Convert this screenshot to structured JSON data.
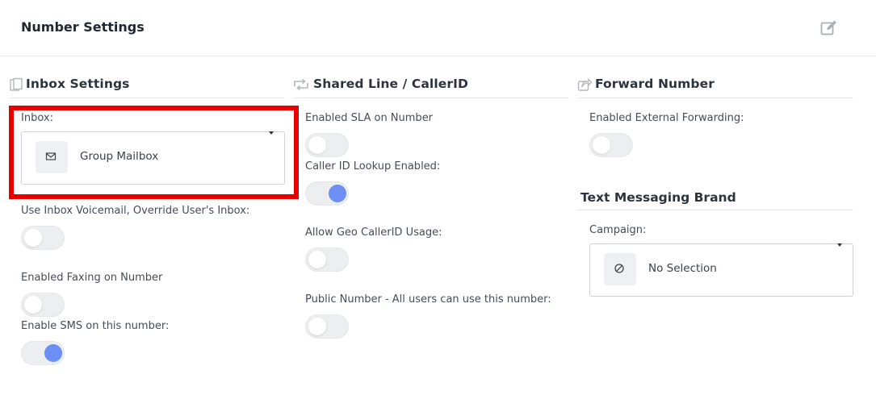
{
  "header": {
    "title": "Number Settings",
    "edit_icon": "edit-icon"
  },
  "inbox_settings": {
    "title": "Inbox Settings",
    "icon": "clipboard-icon",
    "inbox_label": "Inbox:",
    "inbox_value": "Group Mailbox",
    "inbox_value_icon": "envelope-icon",
    "voicemail_label": "Use Inbox Voicemail, Override User's Inbox:",
    "voicemail_enabled": false,
    "faxing_label": "Enabled Faxing on Number",
    "faxing_enabled": false,
    "sms_label": "Enable SMS on this number:",
    "sms_enabled": true
  },
  "shared_line": {
    "title": "Shared Line / CallerID",
    "icon": "retweet-icon",
    "sla_label": "Enabled SLA on Number",
    "sla_enabled": false,
    "callerid_lookup_label": "Caller ID Lookup Enabled:",
    "callerid_lookup_enabled": true,
    "geo_callerid_label": "Allow Geo CallerID Usage:",
    "geo_callerid_enabled": false,
    "public_number_label": "Public Number - All users can use this number:",
    "public_number_enabled": false
  },
  "forward_number": {
    "title": "Forward Number",
    "icon": "share-icon",
    "external_forwarding_label": "Enabled External Forwarding:",
    "external_forwarding_enabled": false
  },
  "text_messaging": {
    "title": "Text Messaging Brand",
    "campaign_label": "Campaign:",
    "campaign_value": "No Selection",
    "campaign_value_icon": "ban-icon"
  },
  "colors": {
    "toggle_on": "#6b8ff5",
    "toggle_off": "#edeef0",
    "highlight": "#e60000"
  }
}
